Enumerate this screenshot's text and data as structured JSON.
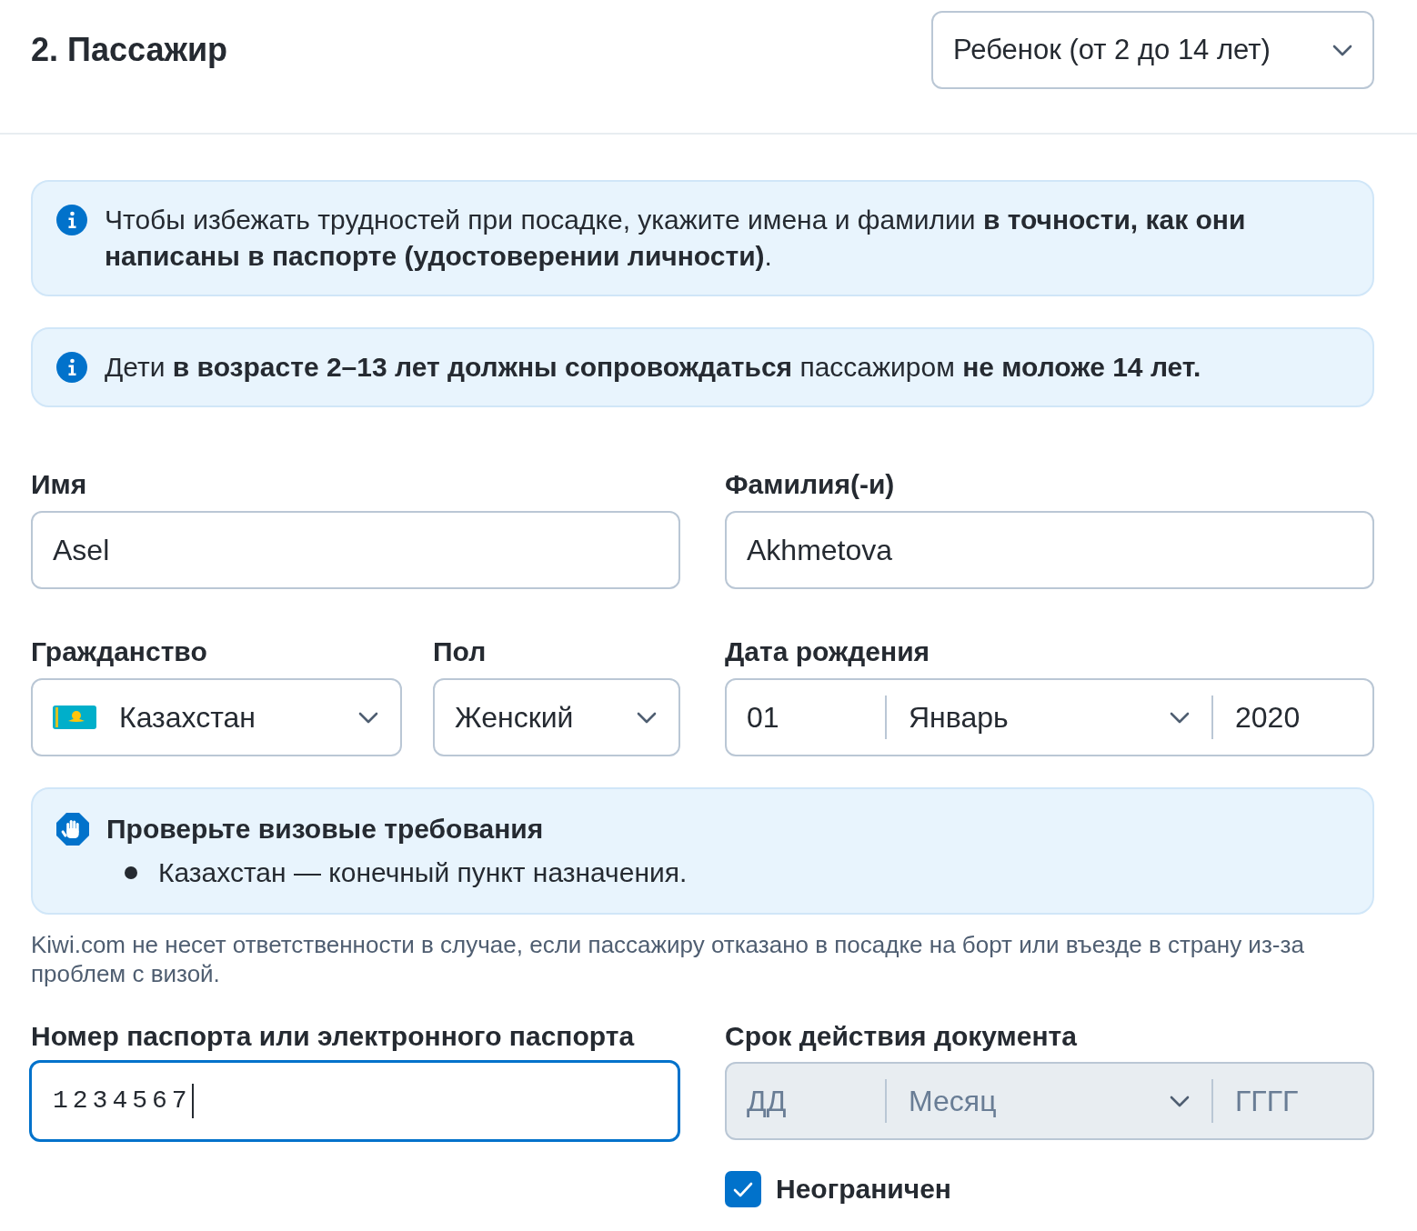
{
  "header": {
    "title": "2. Пассажир",
    "passenger_type": "Ребенок (от 2 до 14 лет)"
  },
  "notices": [
    {
      "kind": "info",
      "text": "Чтобы избежать трудностей при посадке, укажите имена и фамилии **в точности, как они написаны в паспорте (удостоверении личности)**."
    },
    {
      "kind": "info",
      "text": "Дети **в возрасте 2–13 лет должны сопровождаться** пассажиром **не моложе 14 лет.**"
    }
  ],
  "name_fields": [
    {
      "label": "Имя",
      "value": "Asel"
    },
    {
      "label": "Фамилия(-и)",
      "value": "Akhmetova"
    }
  ],
  "nationality": {
    "label": "Гражданство",
    "value": "Казахстан"
  },
  "gender": {
    "label": "Пол",
    "value": "Женский"
  },
  "birth_date": {
    "label": "Дата рождения",
    "day": "01",
    "month": "Январь",
    "year": "2020"
  },
  "visa_notice": {
    "kind": "stop",
    "title": "Проверьте визовые требования",
    "items": [
      "Казахстан — конечный пункт назначения."
    ]
  },
  "disclaimer": "Kiwi.com не несет ответственности в случае, если пассажиру отказано в посадке на борт или въезде в страну из-за проблем с визой.",
  "passport": {
    "label": "Номер паспорта или электронного паспорта",
    "value": "1234567",
    "focused": true
  },
  "expiry": {
    "label": "Срок действия документа",
    "disabled": true,
    "day": {
      "placeholder": "ДД"
    },
    "month": {
      "placeholder": "Месяц"
    },
    "year": {
      "placeholder": "ГГГГ"
    }
  },
  "unlimited": {
    "label": "Неограничен",
    "checked": true
  }
}
